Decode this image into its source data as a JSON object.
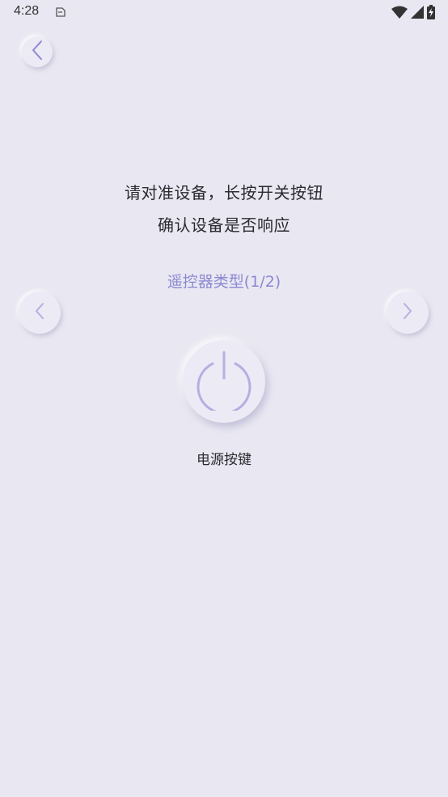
{
  "status_bar": {
    "time": "4:28",
    "icons": [
      "sim-card-icon",
      "wifi-icon",
      "cellular-signal-icon",
      "battery-charging-icon"
    ]
  },
  "navigation": {
    "back_icon": "chevron-left-icon"
  },
  "instructions": {
    "line1": "请对准设备，长按开关按钮",
    "line2": "确认设备是否响应"
  },
  "remote_type": {
    "label": "遥控器类型(1/2)",
    "prev_icon": "chevron-left-icon",
    "next_icon": "chevron-right-icon"
  },
  "power_key": {
    "icon": "power-icon",
    "label": "电源按键"
  },
  "colors": {
    "background": "#e9e8f2",
    "accent": "#8c87d2",
    "icon_stroke": "#b3b0e0",
    "text": "#2a2a30"
  }
}
